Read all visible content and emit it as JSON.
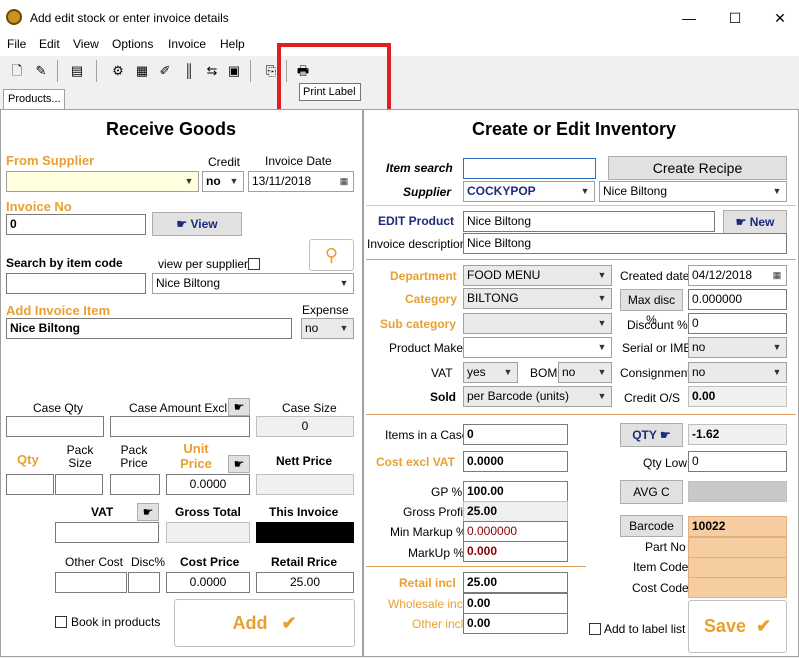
{
  "window": {
    "title": "Add edit stock or enter invoice details",
    "minimize": "—",
    "maximize": "☐",
    "close": "✕"
  },
  "menu": [
    "File",
    "Edit",
    "View",
    "Options",
    "Invoice",
    "Help"
  ],
  "tooltip": "Print Label",
  "tab": "Products...",
  "left": {
    "heading": "Receive Goods",
    "from_supplier": "From Supplier",
    "credit_label": "Credit",
    "credit_value": "no",
    "invoice_date_label": "Invoice Date",
    "invoice_date": "13/11/2018",
    "invoice_no_label": "Invoice No",
    "invoice_no": "0",
    "view_button": "View",
    "search_code_label": "Search by item code",
    "view_per_supplier": "view per supplier",
    "supplier_select": "Nice Biltong",
    "add_invoice_item": "Add Invoice Item",
    "invoice_item": "Nice Biltong",
    "expense_label": "Expense",
    "expense_value": "no",
    "case_qty": "Case Qty",
    "case_amount_excl": "Case Amount Excl",
    "case_size": "Case Size",
    "case_size_value": "0",
    "qty": "Qty",
    "pack_size": "Pack Size",
    "pack_price": "Pack Price",
    "unit_price": "Unit Price",
    "unit_price_value": "0.0000",
    "nett_price": "Nett Price",
    "vat": "VAT",
    "gross_total": "Gross Total",
    "this_invoice": "This Invoice",
    "other_cost": "Other Cost",
    "disc": "Disc%",
    "cost_price": "Cost Price",
    "cost_price_value": "0.0000",
    "retail_price": "Retail Rrice",
    "retail_price_value": "25.00",
    "book_in_products": "Book in products",
    "add_button": "Add"
  },
  "right": {
    "heading": "Create or Edit Inventory",
    "item_search": "Item search",
    "create_recipe": "Create Recipe",
    "supplier_label": "Supplier",
    "supplier_code": "COCKYPOP",
    "supplier_name": "Nice Biltong",
    "edit_product": "EDIT Product",
    "product_name": "Nice Biltong",
    "new_button": "New",
    "invoice_description": "Invoice description",
    "description_value": "Nice Biltong",
    "department": "Department",
    "department_value": "FOOD MENU",
    "created_date": "Created date",
    "created_date_value": "04/12/2018",
    "category": "Category",
    "category_value": "BILTONG",
    "max_disc": "Max disc %",
    "max_disc_value": "0.000000",
    "sub_category": "Sub category",
    "discount": "Discount %",
    "discount_value": "0",
    "product_make": "Product Make",
    "serial_or_ime": "Serial or IME",
    "serial_value": "no",
    "vat": "VAT",
    "vat_value": "yes",
    "bom": "BOM",
    "bom_value": "no",
    "consignment": "Consignment",
    "consignment_value": "no",
    "sold": "Sold",
    "sold_value": "per Barcode (units)",
    "credit_os": "Credit O/S",
    "credit_os_value": "0.00",
    "items_in_case": "Items in a Case",
    "items_in_case_value": "0",
    "qty_button": "QTY",
    "qty_value": "-1.62",
    "cost_excl_vat": "Cost excl VAT",
    "cost_excl_value": "0.0000",
    "qty_low": "Qty Low",
    "qty_low_value": "0",
    "gp": "GP %",
    "gp_value": "100.00",
    "avg_c": "AVG C",
    "gross_profit": "Gross Profit",
    "gross_profit_value": "25.00",
    "min_markup": "Min Markup %",
    "min_markup_value": "0.000000",
    "markup": "MarkUp %",
    "markup_value": "0.000",
    "barcode": "Barcode",
    "barcode_value": "10022",
    "part_no": "Part No",
    "item_code": "Item Code",
    "cost_code": "Cost Code",
    "retail_incl": "Retail incl",
    "retail_incl_value": "25.00",
    "wholesale_incl": "Wholesale incl",
    "wholesale_value": "0.00",
    "other_incl": "Other incl",
    "other_value": "0.00",
    "add_to_label_list": "Add to label list",
    "save_button": "Save"
  }
}
